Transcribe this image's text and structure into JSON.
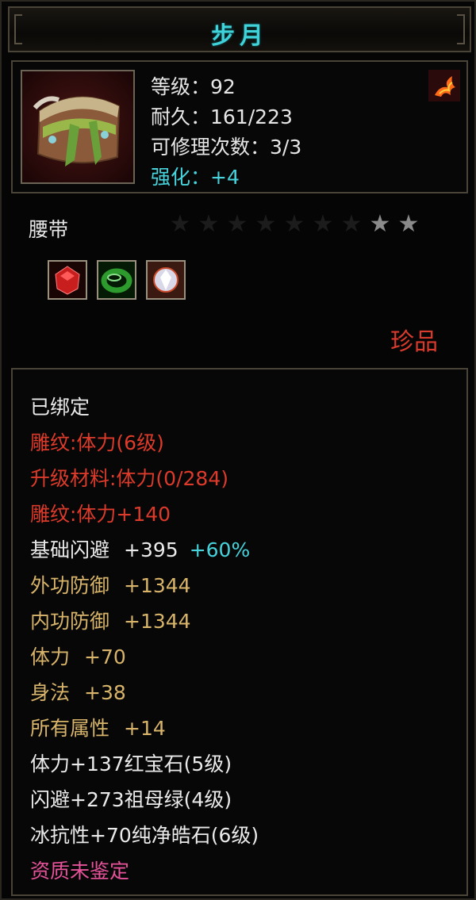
{
  "item": {
    "name": "步月",
    "level_line": "等级：92",
    "durability_line": "耐久：161/223",
    "repair_line": "可修理次数：3/3",
    "enhance_line": "强化：+4",
    "type": "腰带",
    "quality": "珍品",
    "stars_total": 9,
    "stars_lit": 2
  },
  "gems": [
    {
      "name": "ruby-gem-icon",
      "color": "#c81e1e"
    },
    {
      "name": "emerald-gem-icon",
      "color": "#2c9a2c"
    },
    {
      "name": "diamond-gem-icon",
      "color": "#d8d8e8"
    }
  ],
  "attributes": [
    {
      "text": "已绑定",
      "color": "white"
    },
    {
      "text": "雕纹:体力(6级)",
      "color": "red"
    },
    {
      "text": "升级材料:体力(0/284)",
      "color": "red"
    },
    {
      "text": "雕纹:体力+140",
      "color": "red"
    },
    {
      "label": "基础闪避",
      "value": "+395",
      "extra": "+60%",
      "color": "white"
    },
    {
      "label": "外功防御",
      "value": "+1344",
      "color": "gold"
    },
    {
      "label": "内功防御",
      "value": "+1344",
      "color": "gold"
    },
    {
      "label": "体力",
      "value": "+70",
      "color": "gold"
    },
    {
      "label": "身法",
      "value": "+38",
      "color": "gold"
    },
    {
      "label": "所有属性",
      "value": "+14",
      "color": "gold"
    },
    {
      "text": "体力+137红宝石(5级)",
      "color": "white"
    },
    {
      "text": "闪避+273祖母绿(4级)",
      "color": "white"
    },
    {
      "text": "冰抗性+70纯净皓石(6级)",
      "color": "white"
    },
    {
      "text": "资质未鉴定",
      "color": "pink"
    }
  ],
  "colors": {
    "title": "#3fd2d8",
    "quality": "#d83a2c",
    "red_text": "#dc3a2a",
    "gold_text": "#d8b46a",
    "cyan_text": "#46d3dc",
    "pink_text": "#e6539a"
  }
}
